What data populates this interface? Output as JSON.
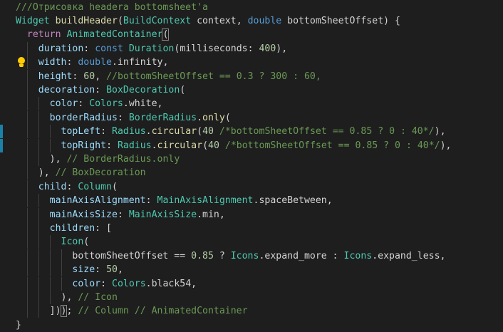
{
  "editor": {
    "colors": {
      "background": "#1e1e1e",
      "default": "#d4d4d4",
      "comment": "#6a9955",
      "keyword": "#569cd6",
      "control": "#c586c0",
      "type": "#4ec9b0",
      "function": "#dcdcaa",
      "property": "#9cdcfe",
      "number": "#b5cea8",
      "lightbulb": "#ffcc00",
      "change_marker": "#1b81a8"
    },
    "lines": [
      [
        {
          "t": "///Отрисовка headera bottomsheet'a",
          "c": "comment"
        }
      ],
      [
        {
          "t": "Widget",
          "c": "type"
        },
        {
          "t": " "
        },
        {
          "t": "buildHeader",
          "c": "function"
        },
        {
          "t": "("
        },
        {
          "t": "BuildContext",
          "c": "type"
        },
        {
          "t": " context, "
        },
        {
          "t": "double",
          "c": "keyword"
        },
        {
          "t": " bottomSheetOffset) {"
        }
      ],
      [
        {
          "t": "  "
        },
        {
          "t": "return",
          "c": "control"
        },
        {
          "t": " "
        },
        {
          "t": "AnimatedContainer",
          "c": "type"
        },
        {
          "t": "(",
          "box": true
        }
      ],
      [
        {
          "t": "    "
        },
        {
          "t": "duration",
          "c": "property"
        },
        {
          "t": ": "
        },
        {
          "t": "const",
          "c": "keyword"
        },
        {
          "t": " "
        },
        {
          "t": "Duration",
          "c": "type"
        },
        {
          "t": "(milliseconds: "
        },
        {
          "t": "400",
          "c": "number"
        },
        {
          "t": "),"
        }
      ],
      [
        {
          "t": "    "
        },
        {
          "t": "width",
          "c": "property"
        },
        {
          "t": ": "
        },
        {
          "t": "double",
          "c": "keyword"
        },
        {
          "t": ".infinity,"
        }
      ],
      [
        {
          "t": "    "
        },
        {
          "t": "height",
          "c": "property"
        },
        {
          "t": ": "
        },
        {
          "t": "60",
          "c": "number"
        },
        {
          "t": ", "
        },
        {
          "t": "//bottomSheetOffset == 0.3 ? 300 : 60,",
          "c": "comment"
        }
      ],
      [
        {
          "t": "    "
        },
        {
          "t": "decoration",
          "c": "property"
        },
        {
          "t": ": "
        },
        {
          "t": "BoxDecoration",
          "c": "type"
        },
        {
          "t": "("
        }
      ],
      [
        {
          "t": "      "
        },
        {
          "t": "color",
          "c": "property"
        },
        {
          "t": ": "
        },
        {
          "t": "Colors",
          "c": "type"
        },
        {
          "t": ".white,"
        }
      ],
      [
        {
          "t": "      "
        },
        {
          "t": "borderRadius",
          "c": "property"
        },
        {
          "t": ": "
        },
        {
          "t": "BorderRadius",
          "c": "type"
        },
        {
          "t": "."
        },
        {
          "t": "only",
          "c": "function"
        },
        {
          "t": "("
        }
      ],
      [
        {
          "t": "        "
        },
        {
          "t": "topLeft",
          "c": "property"
        },
        {
          "t": ": "
        },
        {
          "t": "Radius",
          "c": "type"
        },
        {
          "t": "."
        },
        {
          "t": "circular",
          "c": "function"
        },
        {
          "t": "("
        },
        {
          "t": "40",
          "c": "number"
        },
        {
          "t": " "
        },
        {
          "t": "/*bottomSheetOffset == 0.85 ? 0 : 40*/",
          "c": "comment"
        },
        {
          "t": "),"
        }
      ],
      [
        {
          "t": "        "
        },
        {
          "t": "topRight",
          "c": "property"
        },
        {
          "t": ": "
        },
        {
          "t": "Radius",
          "c": "type"
        },
        {
          "t": "."
        },
        {
          "t": "circular",
          "c": "function"
        },
        {
          "t": "("
        },
        {
          "t": "40",
          "c": "number"
        },
        {
          "t": " "
        },
        {
          "t": "/*bottomSheetOffset == 0.85 ? 0 : 40*/",
          "c": "comment"
        },
        {
          "t": "),"
        }
      ],
      [
        {
          "t": "      ), "
        },
        {
          "t": "// BorderRadius.only",
          "c": "comment"
        }
      ],
      [
        {
          "t": "    ), "
        },
        {
          "t": "// BoxDecoration",
          "c": "comment"
        }
      ],
      [
        {
          "t": "    "
        },
        {
          "t": "child",
          "c": "property"
        },
        {
          "t": ": "
        },
        {
          "t": "Column",
          "c": "type"
        },
        {
          "t": "("
        }
      ],
      [
        {
          "t": "      "
        },
        {
          "t": "mainAxisAlignment",
          "c": "property"
        },
        {
          "t": ": "
        },
        {
          "t": "MainAxisAlignment",
          "c": "type"
        },
        {
          "t": ".spaceBetween,"
        }
      ],
      [
        {
          "t": "      "
        },
        {
          "t": "mainAxisSize",
          "c": "property"
        },
        {
          "t": ": "
        },
        {
          "t": "MainAxisSize",
          "c": "type"
        },
        {
          "t": ".min,"
        }
      ],
      [
        {
          "t": "      "
        },
        {
          "t": "children",
          "c": "property"
        },
        {
          "t": ": ["
        }
      ],
      [
        {
          "t": "        "
        },
        {
          "t": "Icon",
          "c": "type"
        },
        {
          "t": "("
        }
      ],
      [
        {
          "t": "          bottomSheetOffset == "
        },
        {
          "t": "0.85",
          "c": "number"
        },
        {
          "t": " ? "
        },
        {
          "t": "Icons",
          "c": "type"
        },
        {
          "t": ".expand_more : "
        },
        {
          "t": "Icons",
          "c": "type"
        },
        {
          "t": ".expand_less,"
        }
      ],
      [
        {
          "t": "          "
        },
        {
          "t": "size",
          "c": "property"
        },
        {
          "t": ": "
        },
        {
          "t": "50",
          "c": "number"
        },
        {
          "t": ","
        }
      ],
      [
        {
          "t": "          "
        },
        {
          "t": "color",
          "c": "property"
        },
        {
          "t": ": "
        },
        {
          "t": "Colors",
          "c": "type"
        },
        {
          "t": ".black54,"
        }
      ],
      [
        {
          "t": "        ), "
        },
        {
          "t": "// Icon",
          "c": "comment"
        }
      ],
      [
        {
          "t": "      ])"
        },
        {
          "t": ")",
          "box": true
        },
        {
          "t": "; "
        },
        {
          "t": "// Column // AnimatedContainer",
          "c": "comment"
        }
      ],
      [
        {
          "t": "}"
        }
      ]
    ]
  }
}
